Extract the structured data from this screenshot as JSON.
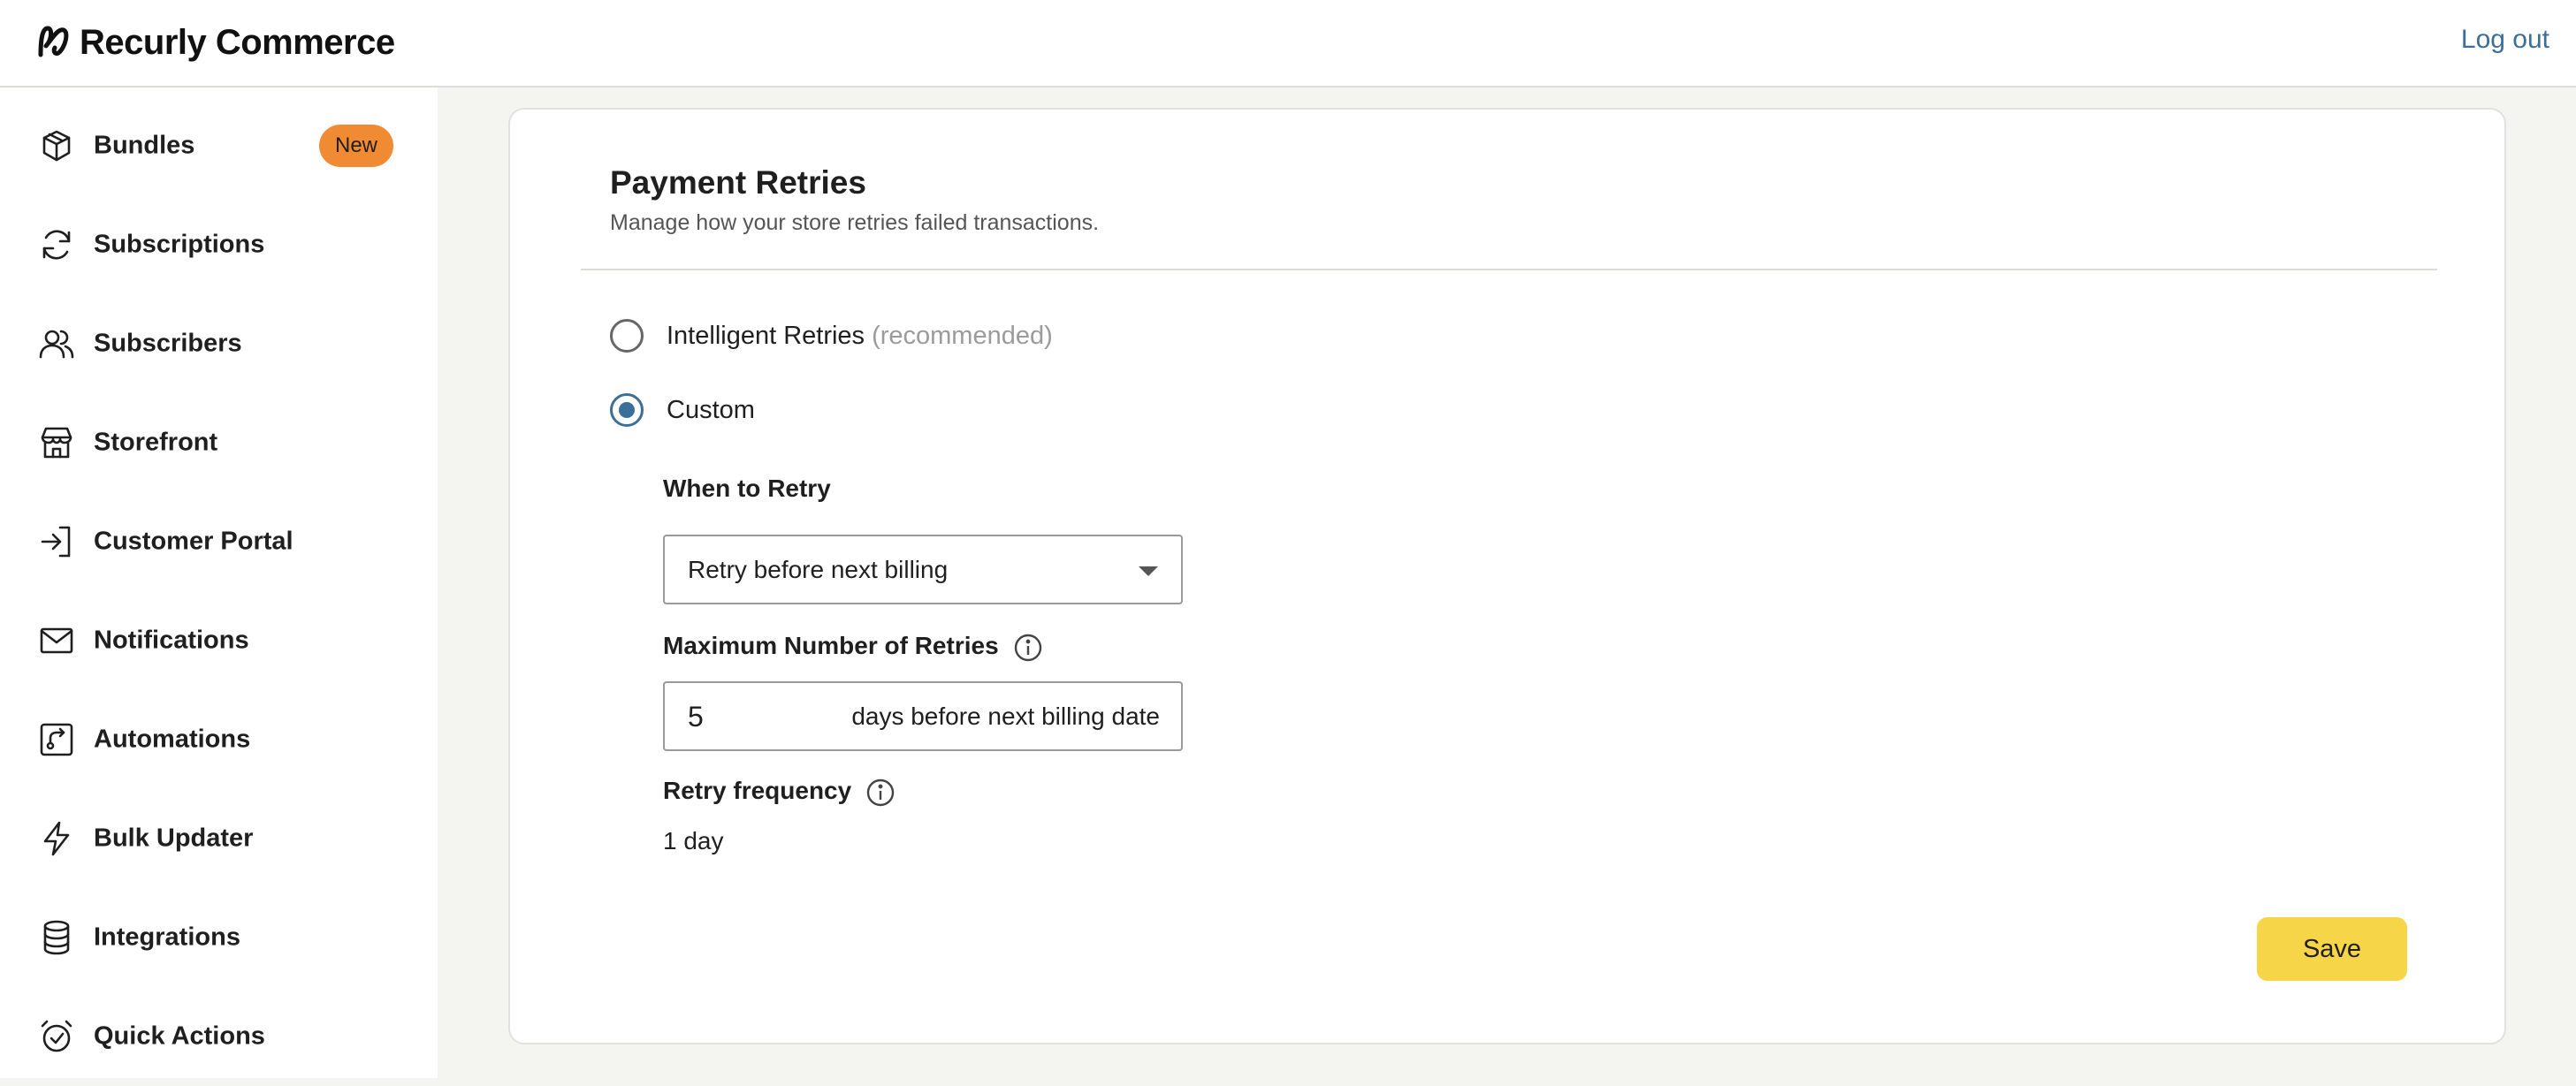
{
  "header": {
    "brand": "Recurly Commerce",
    "logout_label": "Log out"
  },
  "sidebar": {
    "items": [
      {
        "label": "Bundles",
        "icon": "box-icon",
        "badge": "New"
      },
      {
        "label": "Subscriptions",
        "icon": "refresh-icon"
      },
      {
        "label": "Subscribers",
        "icon": "users-icon"
      },
      {
        "label": "Storefront",
        "icon": "store-icon"
      },
      {
        "label": "Customer Portal",
        "icon": "login-icon"
      },
      {
        "label": "Notifications",
        "icon": "mail-icon"
      },
      {
        "label": "Automations",
        "icon": "automation-icon"
      },
      {
        "label": "Bulk Updater",
        "icon": "bolt-icon"
      },
      {
        "label": "Integrations",
        "icon": "database-icon"
      },
      {
        "label": "Quick Actions",
        "icon": "alarm-clock-icon"
      }
    ]
  },
  "main": {
    "title": "Payment Retries",
    "subtitle": "Manage how your store retries failed transactions.",
    "options": [
      {
        "label": "Intelligent Retries",
        "hint": "(recommended)",
        "selected": false
      },
      {
        "label": "Custom",
        "selected": true
      }
    ],
    "when_to_retry": {
      "label": "When to Retry",
      "selected": "Retry before next billing"
    },
    "max_retries": {
      "label": "Maximum Number of Retries",
      "value": "5",
      "suffix": "days before next billing date"
    },
    "retry_frequency": {
      "label": "Retry frequency",
      "value": "1 day"
    },
    "save_label": "Save"
  },
  "colors": {
    "accent": "#3b6e99",
    "badge": "#f08a33",
    "save_button": "#f7d548",
    "page_background": "#f4f4f0"
  }
}
